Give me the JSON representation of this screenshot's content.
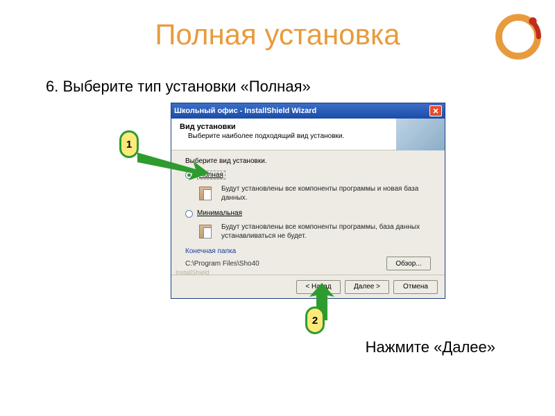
{
  "slide": {
    "title": "Полная установка",
    "step_text": "6. Выберите тип установки «Полная»",
    "note_text": "Нажмите «Далее»"
  },
  "dialog": {
    "window_title": "Школьный офис - InstallShield Wizard",
    "heading": "Вид установки",
    "subheading": "Выберите наиболее подходящий вид установки.",
    "prompt": "Выберите вид установки.",
    "options": [
      {
        "label": "Полная",
        "desc": "Будут установлены все компоненты программы и новая база данных.",
        "selected": true
      },
      {
        "label": "Минимальная",
        "desc": "Будут установлены все компоненты программы, база данных устанавливаться не будет.",
        "selected": false
      }
    ],
    "dest_label": "Конечная папка",
    "dest_path": "C:\\Program Files\\Sho40",
    "browse_btn": "Обзор...",
    "watermark": "InstallShield",
    "buttons": {
      "back": "< Назад",
      "next": "Далее >",
      "cancel": "Отмена"
    }
  },
  "callouts": [
    {
      "num": "1"
    },
    {
      "num": "2"
    }
  ]
}
